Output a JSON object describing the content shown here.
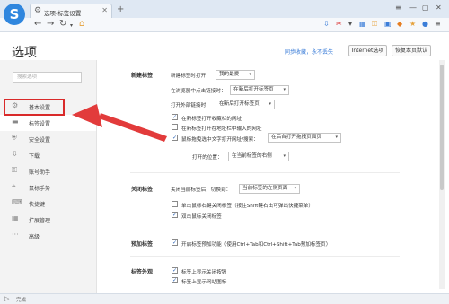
{
  "browser": {
    "tab_title": "选项-标签设置",
    "logo_letter": "S"
  },
  "page": {
    "title": "选项",
    "sync_link": "同步收藏，永不丢失",
    "internet_options": "Internet选项",
    "restore_defaults": "恢复本页默认"
  },
  "sidebar": {
    "search_placeholder": "搜索选项",
    "items": [
      {
        "label": "基本设置",
        "icon": "gear-icon"
      },
      {
        "label": "标签设置",
        "icon": "tab-icon"
      },
      {
        "label": "安全设置",
        "icon": "shield-icon"
      },
      {
        "label": "下载",
        "icon": "download-icon"
      },
      {
        "label": "账号助手",
        "icon": "key-icon"
      },
      {
        "label": "鼠标手势",
        "icon": "mouse-icon"
      },
      {
        "label": "快捷键",
        "icon": "keyboard-icon"
      },
      {
        "label": "扩展管理",
        "icon": "puzzle-icon"
      },
      {
        "label": "高级",
        "icon": "more-icon"
      }
    ]
  },
  "sections": {
    "new_tab": {
      "label": "新建标签",
      "new_tab_open_text": "新建标签时打开：",
      "new_tab_open_value": "我的最爱",
      "addr_open_text": "在浏览器中点击链接时：",
      "addr_open_value": "在新后打开标签页",
      "external_link_text": "打开外部链接时：",
      "external_link_value": "在新后打开标签页",
      "check1": "在新标签打开收藏栏的网址",
      "check2": "在新标签打开在地址栏中输入的网址",
      "check3": "鼠标拖曳选中文字打开网址/搜索：",
      "check3_value": "在后台打开拖拽页面页",
      "open_position_text": "打开的位置：",
      "open_position_value": "在当前标签的右侧"
    },
    "close_tab": {
      "label": "关闭标签",
      "close_text": "关闭当前标签后，切换到：",
      "close_value": "当前标签的左侧页面",
      "check1": "单击鼠标右键关闭标签（按住Shift键右击可弹出快捷菜单）",
      "check2": "双击鼠标关闭标签"
    },
    "preload": {
      "label": "预加标签",
      "check1": "开启标签预加功能（使用Ctrl+Tab和Ctrl+Shift+Tab预加标签页）"
    },
    "appearance": {
      "label": "标签外观",
      "check1": "标签上显示关闭按钮",
      "check2": "标签上显示网站图标"
    }
  },
  "status": {
    "text": "完成"
  },
  "colors": {
    "accent": "#2f86de",
    "highlight": "#d92a2a",
    "link": "#3b7dd8"
  }
}
